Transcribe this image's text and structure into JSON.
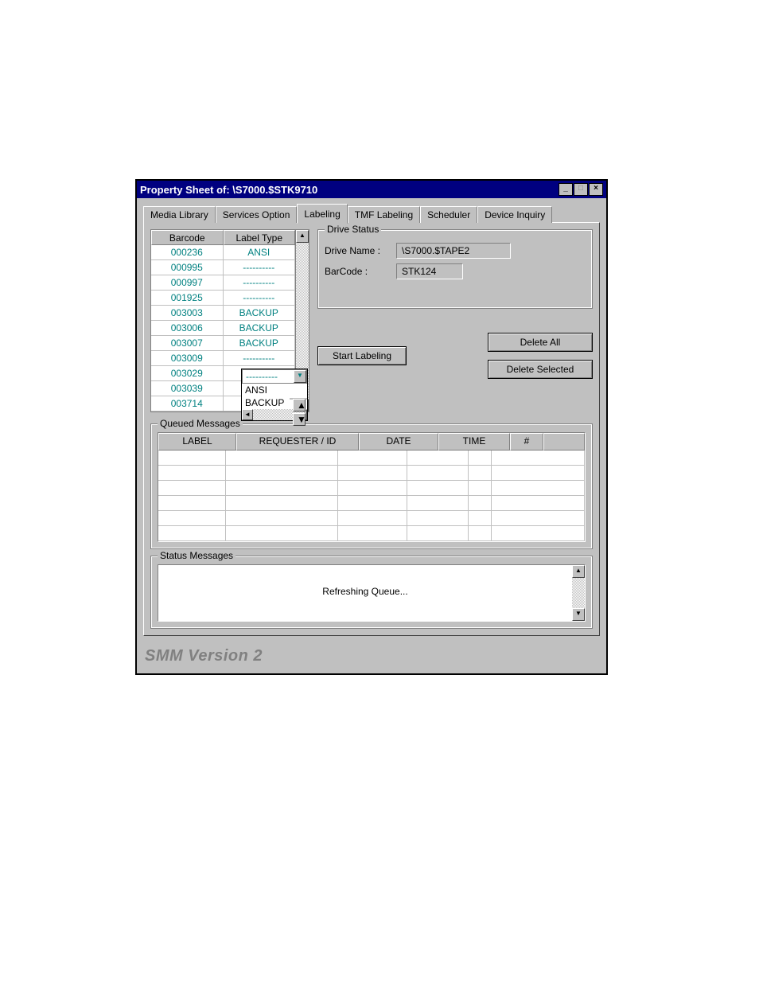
{
  "window_title": "Property Sheet of: \\S7000.$STK9710",
  "tabs": {
    "items": [
      {
        "label": "Media Library"
      },
      {
        "label": "Services Option"
      },
      {
        "label": "Labeling"
      },
      {
        "label": "TMF Labeling"
      },
      {
        "label": "Scheduler"
      },
      {
        "label": "Device Inquiry"
      }
    ],
    "active_index": 2
  },
  "barcode_table": {
    "headers": {
      "col0": "Barcode",
      "col1": "Label Type"
    },
    "rows": [
      {
        "barcode": "000236",
        "label_type": "ANSI"
      },
      {
        "barcode": "000995",
        "label_type": "----------"
      },
      {
        "barcode": "000997",
        "label_type": "----------"
      },
      {
        "barcode": "001925",
        "label_type": "----------"
      },
      {
        "barcode": "003003",
        "label_type": "BACKUP"
      },
      {
        "barcode": "003006",
        "label_type": "BACKUP"
      },
      {
        "barcode": "003007",
        "label_type": "BACKUP"
      },
      {
        "barcode": "003009",
        "label_type": "----------"
      },
      {
        "barcode": "003029",
        "label_type": "----------"
      },
      {
        "barcode": "003039",
        "label_type": ""
      },
      {
        "barcode": "003714",
        "label_type": ""
      }
    ]
  },
  "label_type_combo": {
    "display": "----------",
    "options": [
      "ANSI",
      "BACKUP"
    ]
  },
  "drive_status": {
    "legend": "Drive Status",
    "drive_name_label": "Drive Name :",
    "drive_name_value": "\\S7000.$TAPE2",
    "barcode_label": "BarCode :",
    "barcode_value": "STK124"
  },
  "buttons": {
    "start_labeling": "Start Labeling",
    "delete_all": "Delete All",
    "delete_selected": "Delete Selected"
  },
  "queued_messages": {
    "legend": "Queued Messages",
    "headers": {
      "label": "LABEL",
      "requester": "REQUESTER / ID",
      "date": "DATE",
      "time": "TIME",
      "num": "#"
    }
  },
  "status_messages": {
    "legend": "Status Messages",
    "text": "Refreshing Queue..."
  },
  "footer": "SMM Version 2"
}
